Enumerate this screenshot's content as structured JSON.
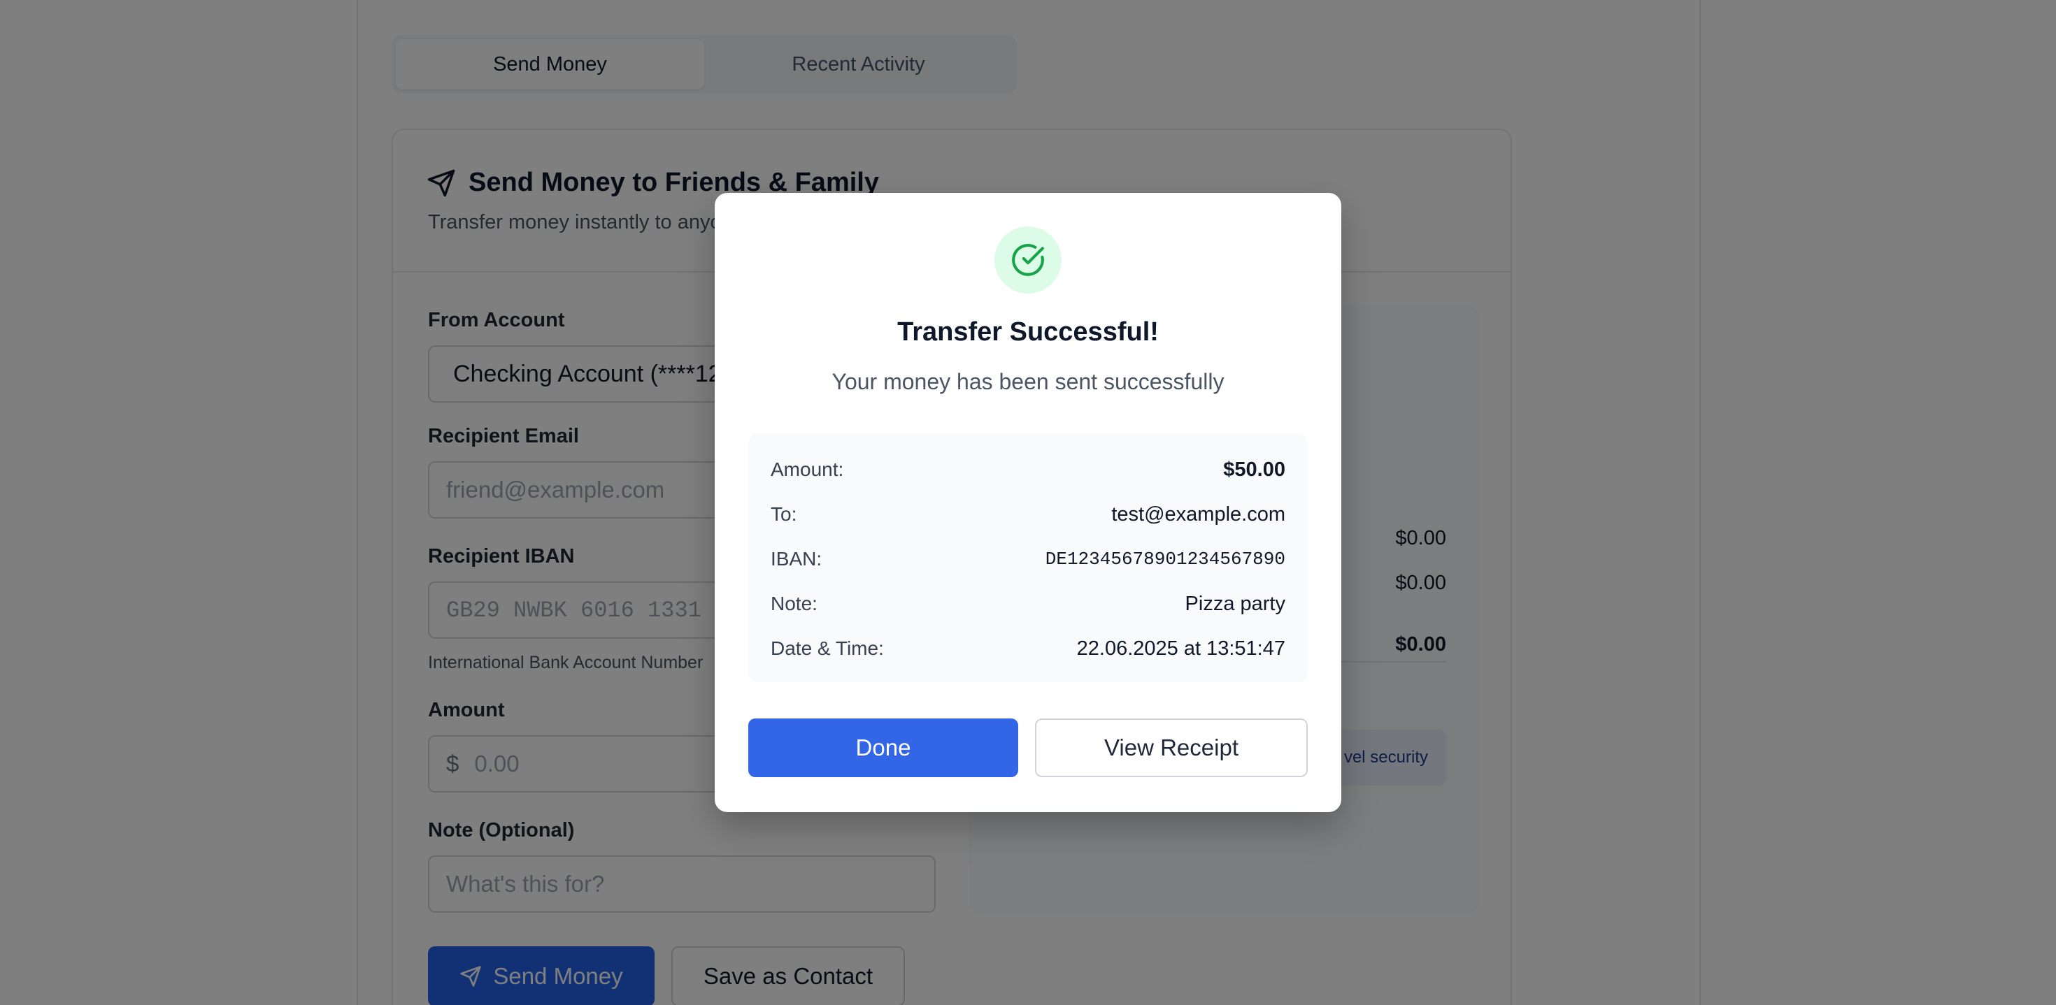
{
  "tabs": [
    {
      "label": "Send Money",
      "active": true
    },
    {
      "label": "Recent Activity",
      "active": false
    }
  ],
  "card": {
    "icon": "send-icon",
    "title": "Send Money to Friends & Family",
    "subtitle": "Transfer money instantly to anyo"
  },
  "form": {
    "from_label": "From Account",
    "from_value": "Checking Account (****12",
    "email_label": "Recipient Email",
    "email_placeholder": "friend@example.com",
    "iban_label": "Recipient IBAN",
    "iban_placeholder": "GB29 NWBK 6016 1331",
    "iban_hint": "International Bank Account Number",
    "amount_label": "Amount",
    "amount_prefix": "$",
    "amount_placeholder": "0.00",
    "note_label": "Note (Optional)",
    "note_placeholder": "What's this for?",
    "send_label": "Send Money",
    "save_contact_label": "Save as Contact"
  },
  "summary": {
    "row1": "$0.00",
    "row2": "$0.00",
    "total": "$0.00",
    "security_text": "vel security"
  },
  "modal": {
    "icon": "check-circle-icon",
    "title": "Transfer Successful!",
    "subtitle": "Your money has been sent successfully",
    "details": [
      {
        "label": "Amount:",
        "value": "$50.00"
      },
      {
        "label": "To:",
        "value": "test@example.com"
      },
      {
        "label": "IBAN:",
        "value": "DE12345678901234567890"
      },
      {
        "label": "Note:",
        "value": "Pizza party"
      },
      {
        "label": "Date & Time:",
        "value": "22.06.2025 at 13:51:47"
      }
    ],
    "done_label": "Done",
    "receipt_label": "View Receipt"
  },
  "colors": {
    "primary": "#2563eb",
    "success_bg": "#dcfce7",
    "success_icon": "#16a34a"
  }
}
